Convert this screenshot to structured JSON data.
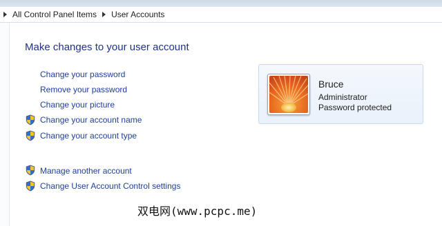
{
  "breadcrumb": {
    "items": [
      "All Control Panel Items",
      "User Accounts"
    ]
  },
  "main": {
    "heading": "Make changes to your user account",
    "tasks": [
      {
        "label": "Change your password",
        "shield": false
      },
      {
        "label": "Remove your password",
        "shield": false
      },
      {
        "label": "Change your picture",
        "shield": false
      },
      {
        "label": "Change your account name",
        "shield": true
      },
      {
        "label": "Change your account type",
        "shield": true
      }
    ],
    "other_tasks": [
      {
        "label": "Manage another account",
        "shield": true
      },
      {
        "label": "Change User Account Control settings",
        "shield": true
      }
    ]
  },
  "user": {
    "name": "Bruce",
    "role": "Administrator",
    "status": "Password protected",
    "picture": "orange-flower-icon"
  },
  "watermark": "双电网(www.pcpc.me)",
  "colors": {
    "link": "#1e3f99",
    "heading": "#1e3287",
    "card_border": "#c9d8ea"
  }
}
